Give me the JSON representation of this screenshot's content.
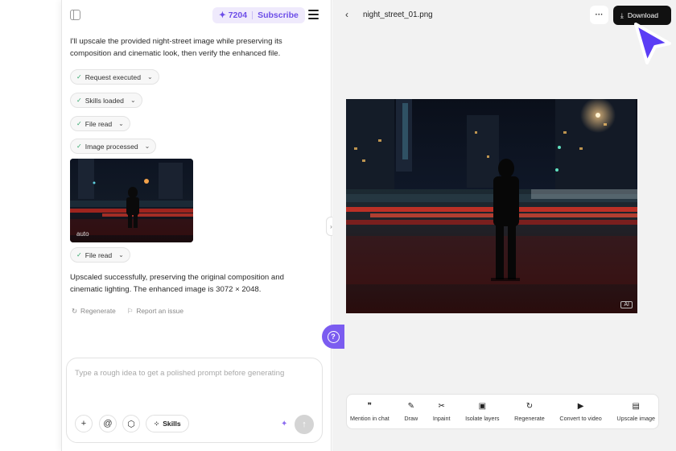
{
  "chat": {
    "credits": "✦ 7204",
    "subscribe_label": "Subscribe",
    "intro_line1": "I'll upscale the provided night-street image while preserving its",
    "intro_line2": "composition and cinematic look, then verify the enhanced file.",
    "chips": [
      {
        "label": "Request executed"
      },
      {
        "label": "Skills loaded"
      },
      {
        "label": "File read"
      },
      {
        "label": "Image processed"
      }
    ],
    "thumbnail_label": "auto",
    "chip_after": "File read",
    "result_line1": "Upscaled successfully, preserving the original composition and",
    "result_line2": "cinematic lighting. The enhanced image is 3072 × 2048.",
    "regenerate_label": "Regenerate",
    "report_label": "Report an issue",
    "composer_placeholder": "Type a rough idea to get a polished prompt before generating",
    "skills_label": "Skills"
  },
  "preview": {
    "file_name": "night_street_01.png",
    "download_label": "Download",
    "ai_badge": "AI",
    "tools": [
      {
        "icon": "quote-icon",
        "glyph": "❞",
        "label": "Mention in chat"
      },
      {
        "icon": "brush-icon",
        "glyph": "✎",
        "label": "Draw"
      },
      {
        "icon": "scissors-icon",
        "glyph": "✂",
        "label": "Inpaint"
      },
      {
        "icon": "layers-icon",
        "glyph": "▣",
        "label": "Isolate layers"
      },
      {
        "icon": "refresh-icon",
        "glyph": "↻",
        "label": "Regenerate"
      },
      {
        "icon": "video-icon",
        "glyph": "▶",
        "label": "Convert to video"
      },
      {
        "icon": "hd-icon",
        "glyph": "▤",
        "label": "Upscale image"
      }
    ]
  },
  "colors": {
    "accent": "#7b5cf0",
    "download_bg": "#111111",
    "panel_bg": "#f2f2f2"
  }
}
